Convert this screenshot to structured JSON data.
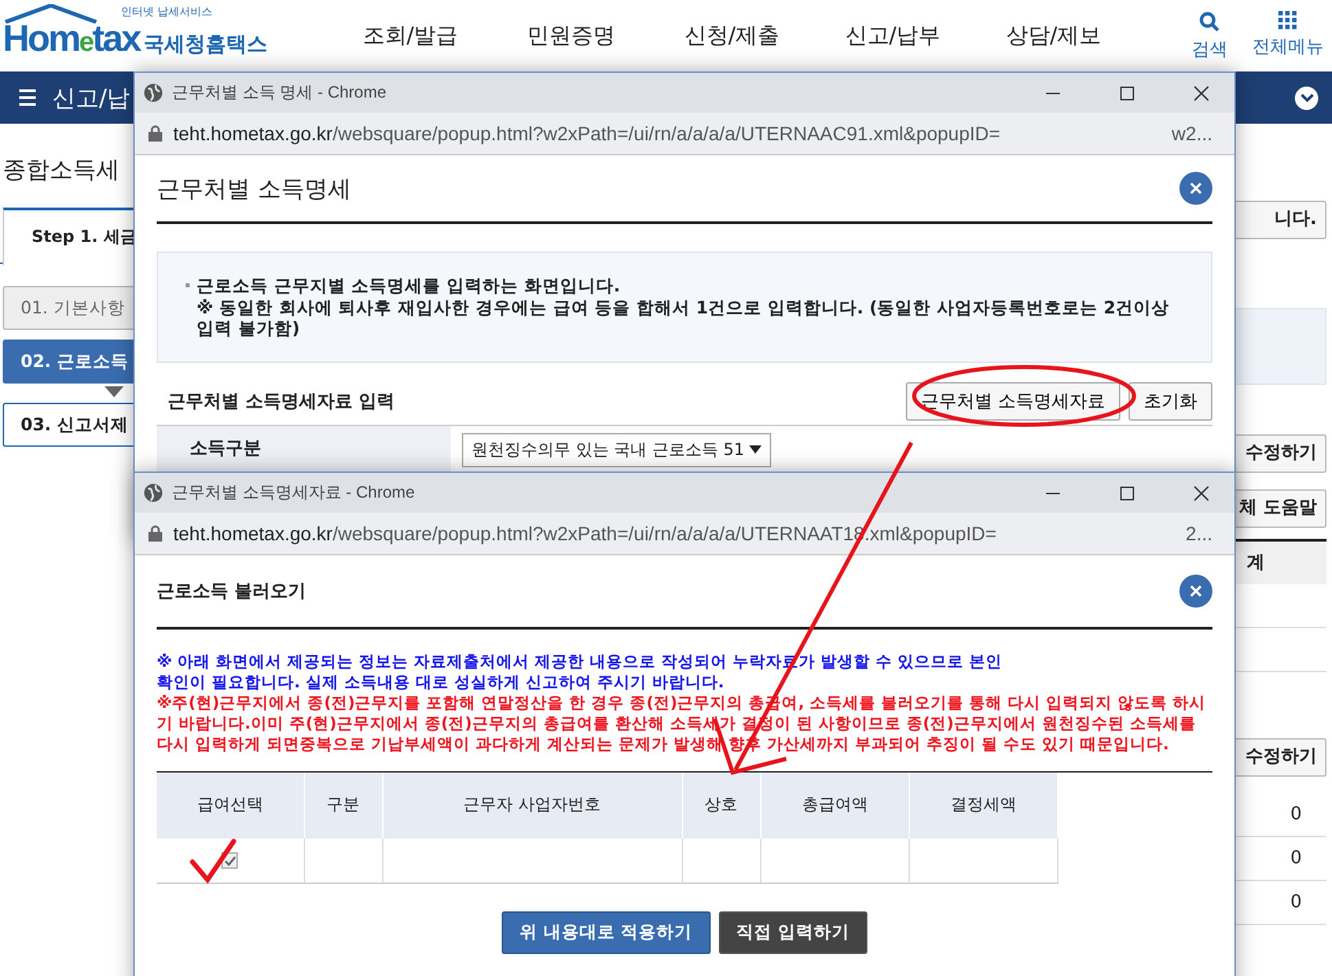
{
  "header": {
    "logo": {
      "tagline": "인터넷 납세서비스",
      "part_a": "Hom",
      "part_e": "e",
      "part_b": "tax",
      "korean": "국세청홈택스"
    },
    "nav": [
      "조회/발급",
      "민원증명",
      "신청/제출",
      "신고/납부",
      "상담/제보"
    ],
    "utilities": [
      {
        "label": "검색",
        "kind": "search"
      },
      {
        "label": "전체메뉴",
        "kind": "grid"
      }
    ]
  },
  "menu_bar": {
    "label": "신고/납"
  },
  "page": {
    "title": "종합소득세",
    "tab": "Step 1. 세금",
    "steps": [
      {
        "label": "01. 기본사항",
        "kind": "done",
        "selected": false
      },
      {
        "label": "02. 근로소득",
        "kind": "current",
        "selected": true
      },
      {
        "label": "03. 신고서제",
        "kind": "pending",
        "selected": false
      }
    ],
    "right_items": [
      {
        "kind": "button",
        "label": "니다."
      },
      {
        "kind": "panel"
      },
      {
        "kind": "button",
        "label": "수정하기"
      },
      {
        "kind": "button",
        "label": "체 도움말"
      },
      {
        "kind": "header",
        "label": "계"
      },
      {
        "kind": "blank"
      },
      {
        "kind": "blank"
      },
      {
        "kind": "button",
        "label": "수정하기"
      },
      {
        "kind": "value",
        "label": "0"
      },
      {
        "kind": "value",
        "label": "0"
      },
      {
        "kind": "value",
        "label": "0"
      }
    ]
  },
  "popup_detail": {
    "window_title": "근무처별 소득 명세 - Chrome",
    "url_host": "teht.hometax.go.kr",
    "url_path": "/websquare/popup.html?w2xPath=/ui/rn/a/a/a/a/UTERNAAC91.xml&popupID=",
    "url_tail": "w2...",
    "heading": "근무처별 소득명세",
    "info": [
      "근로소득 근무지별 소득명세를 입력하는 화면입니다.",
      "※ 동일한 회사에 퇴사후 재입사한 경우에는 급여 등을 합해서 1건으로 입력합니다. (동일한 사업자등록번호로는 2건이상 입력 불가함)"
    ],
    "section": "근무처별 소득명세자료 입력",
    "buttons": [
      "근무처별 소득명세자료",
      "초기화"
    ],
    "field_label": "소득구분",
    "field_value": "원천징수의무 있는 국내 근로소득 51"
  },
  "popup_import": {
    "window_title": "근무처별 소득명세자료 - Chrome",
    "url_host": "teht.hometax.go.kr",
    "url_path": "/websquare/popup.html?w2xPath=/ui/rn/a/a/a/a/UTERNAAT18.xml&popupID=",
    "url_tail": "2...",
    "heading": "근로소득 불러오기",
    "notice_blue": "※ 아래 화면에서 제공되는 정보는 자료제출처에서 제공한 내용으로 작성되어 누락자료가 발생할 수 있으므로 본인 확인이 필요합니다. 실제 소득내용 대로 성실하게 신고하여 주시기 바랍니다.",
    "notice_red": "※주(현)근무지에서 종(전)근무지를 포함해 연말정산을 한 경우 종(전)근무지의 총급여, 소득세를 불러오기를 통해 다시 입력되지 않도록 하시기 바랍니다.이미 주(현)근무지에서 종(전)근무지의 총급여를 환산해 소득세가 결정이 된 사항이므로 종(전)근무지에서 원천징수된 소득세를 다시 입력하게 되면중복으로 기납부세액이 과다하게 계산되는 문제가 발생해 향후 가산세까지 부과되어 추징이 될 수도 있기 때문입니다.",
    "columns": [
      "급여선택",
      "구분",
      "근무자 사업자번호",
      "상호",
      "총급여액",
      "결정세액"
    ],
    "rows": [
      {
        "checked": true
      }
    ],
    "buttons": [
      {
        "label": "위 내용대로 적용하기",
        "kind": "primary"
      },
      {
        "label": "직접 입력하기",
        "kind": "dark"
      }
    ]
  }
}
